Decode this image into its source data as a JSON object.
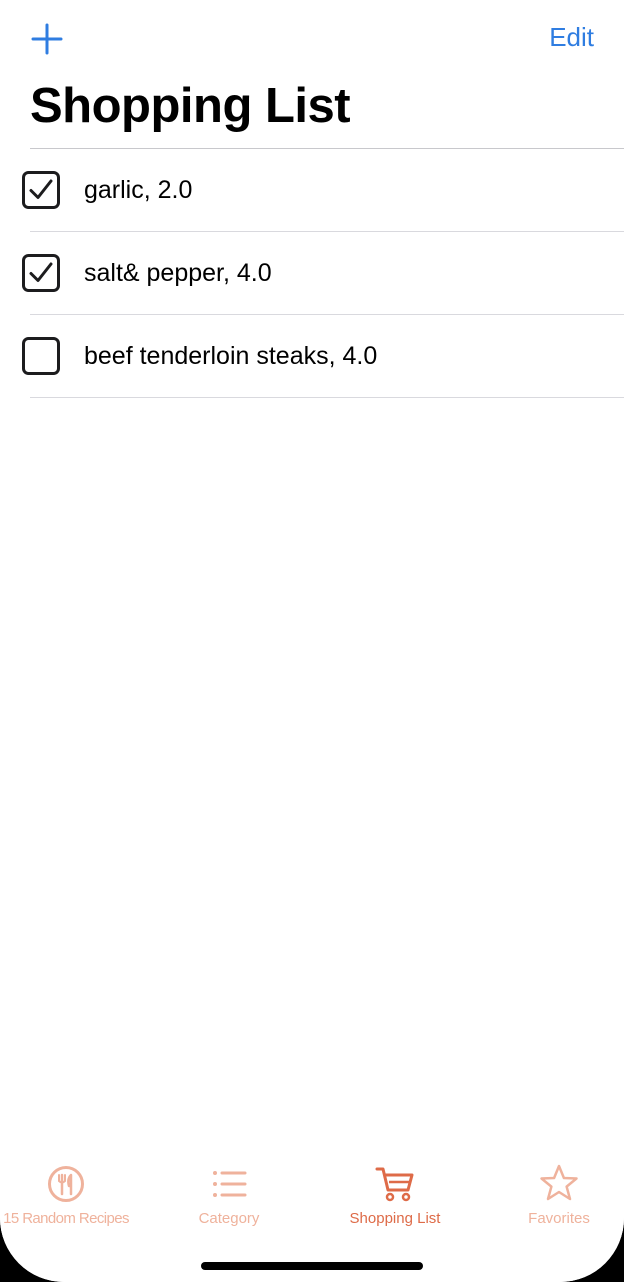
{
  "navbar": {
    "add_icon": "plus-icon",
    "edit_label": "Edit",
    "title": "Shopping List"
  },
  "items": [
    {
      "label": "garlic, 2.0",
      "checked": true
    },
    {
      "label": "salt& pepper, 4.0",
      "checked": true
    },
    {
      "label": "beef tenderloin steaks, 4.0",
      "checked": false
    }
  ],
  "tabs": [
    {
      "label": "15 Random Recipes",
      "icon": "fork-knife-plate-icon",
      "selected": false
    },
    {
      "label": "Category",
      "icon": "list-icon",
      "selected": false
    },
    {
      "label": "Shopping List",
      "icon": "cart-icon",
      "selected": true
    },
    {
      "label": "Favorites",
      "icon": "star-icon",
      "selected": false
    }
  ],
  "colors": {
    "accent": "#2f7de1",
    "tab_selected": "#de6b48",
    "tab_unselected": "#efb29c"
  }
}
